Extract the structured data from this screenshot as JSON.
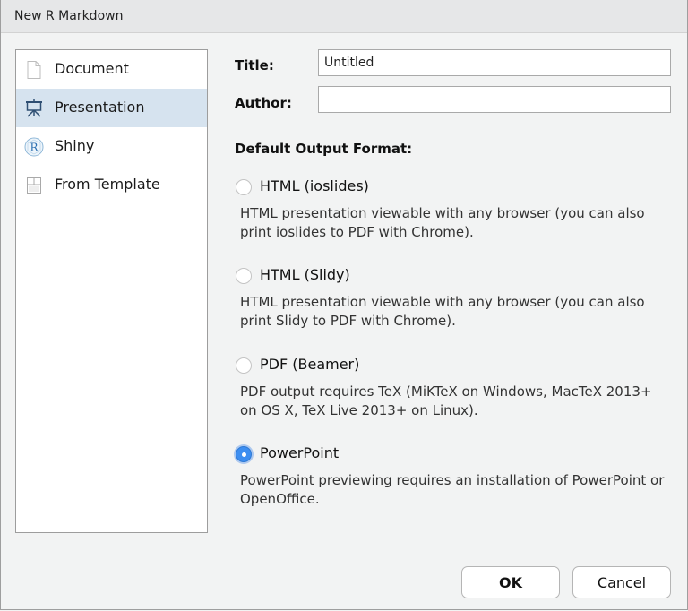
{
  "window": {
    "title": "New R Markdown"
  },
  "sidebar": {
    "items": [
      {
        "label": "Document",
        "icon": "document-icon",
        "selected": false
      },
      {
        "label": "Presentation",
        "icon": "presentation-easel-icon",
        "selected": true
      },
      {
        "label": "Shiny",
        "icon": "shiny-r-icon",
        "selected": false
      },
      {
        "label": "From Template",
        "icon": "template-icon",
        "selected": false
      }
    ]
  },
  "form": {
    "title_label": "Title:",
    "title_value": "Untitled",
    "author_label": "Author:",
    "author_value": ""
  },
  "output_format": {
    "heading": "Default Output Format:",
    "options": [
      {
        "label": "HTML (ioslides)",
        "description": "HTML presentation viewable with any browser (you can also print ioslides to PDF with Chrome).",
        "checked": false
      },
      {
        "label": "HTML (Slidy)",
        "description": "HTML presentation viewable with any browser (you can also print Slidy to PDF with Chrome).",
        "checked": false
      },
      {
        "label": "PDF (Beamer)",
        "description": "PDF output requires TeX (MiKTeX on Windows, MacTeX 2013+ on OS X, TeX Live 2013+ on Linux).",
        "checked": false
      },
      {
        "label": "PowerPoint",
        "description": "PowerPoint previewing requires an installation of PowerPoint or OpenOffice.",
        "checked": true
      }
    ]
  },
  "buttons": {
    "ok": "OK",
    "cancel": "Cancel"
  },
  "colors": {
    "selection": "#d6e3ef",
    "radio_checked": "#3d8ef0",
    "background": "#f2f3f3"
  }
}
